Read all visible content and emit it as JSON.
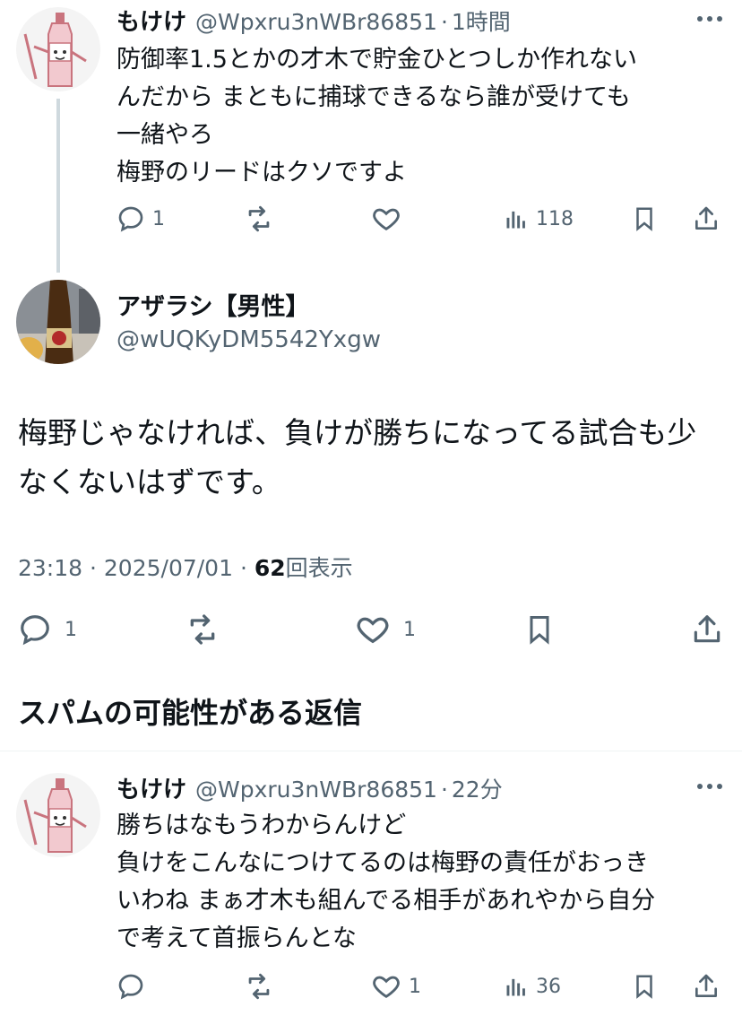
{
  "reply1": {
    "name": "もけけ",
    "handle": "@Wpxru3nWBr86851",
    "sep": "·",
    "time": "1時間",
    "lines": [
      "防御率1.5とかの才木で貯金ひとつしか作れない",
      "んだから まともに捕球できるなら誰が受けても",
      "一緒やろ",
      "梅野のリードはクソですよ"
    ],
    "replies": "1",
    "retweets": "",
    "likes": "",
    "views": "118"
  },
  "main": {
    "name": "アザラシ【男性】",
    "handle": "@wUQKyDM5542Yxgw",
    "lines": [
      "梅野じゃなければ、負けが勝ちになってる試合も少",
      "なくないはずです。"
    ],
    "time": "23:18",
    "date": "2025/07/01",
    "dot": "·",
    "views": "62",
    "views_label": "回表示",
    "replies": "1",
    "retweets": "",
    "likes": "1"
  },
  "spam_section": {
    "title": "スパムの可能性がある返信"
  },
  "reply2": {
    "name": "もけけ",
    "handle": "@Wpxru3nWBr86851",
    "sep": "·",
    "time": "22分",
    "lines": [
      "勝ちはなもうわからんけど",
      "負けをこんなにつけてるのは梅野の責任がおっき",
      "いわね まぁ才木も組んでる相手があれやから自分",
      "で考えて首振らんとな"
    ],
    "replies": "",
    "retweets": "",
    "likes": "1",
    "views": "36"
  },
  "icons": {
    "reply": "reply-icon",
    "retweet": "retweet-icon",
    "like": "heart-icon",
    "views": "views-icon",
    "bookmark": "bookmark-icon",
    "share": "share-icon",
    "more": "more-icon"
  },
  "colors": {
    "text": "#0f1419",
    "secondary": "#536471",
    "thread_line": "#cfd9de",
    "divider": "#eff3f4"
  }
}
